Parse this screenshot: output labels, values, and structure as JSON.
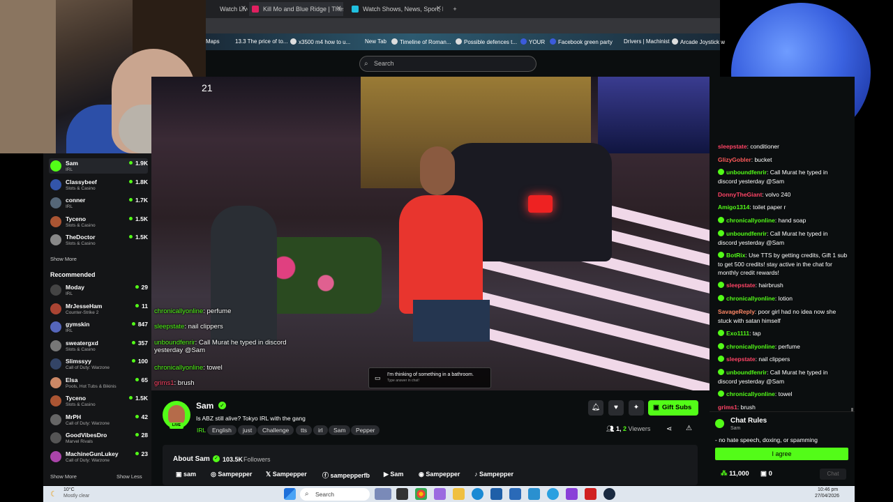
{
  "browser": {
    "tabs": [
      {
        "label": "Watch Live on"
      },
      {
        "label": "Kill Mo and Blue Ridge | These"
      },
      {
        "label": "Watch Shows, News, Sport, Mo"
      }
    ],
    "bookmarks": [
      "Maps",
      "13.3 The price of to...",
      "x3500 m4 how to u...",
      "New Tab",
      "Timeline of Roman...",
      "Possible defences t...",
      "YOUR",
      "Facebook green party",
      "Drivers | Machinist",
      "Arcade Joystick w"
    ]
  },
  "search": {
    "placeholder": "Search"
  },
  "sidebar": {
    "following": [
      {
        "name": "Sam",
        "category": "IRL",
        "viewers": "1.9K",
        "color": "#53fc18"
      },
      {
        "name": "Classybeef",
        "category": "Slots & Casino",
        "viewers": "1.8K",
        "color": "#3355aa"
      },
      {
        "name": "conner",
        "category": "IRL",
        "viewers": "1.7K",
        "color": "#556677"
      },
      {
        "name": "Tyceno",
        "category": "Slots & Casino",
        "viewers": "1.5K",
        "color": "#aa5533"
      },
      {
        "name": "TheDoctor",
        "category": "Slots & Casino",
        "viewers": "1.5K",
        "color": "#888888"
      }
    ],
    "show_more": "Show More",
    "recommended_heading": "Recommended",
    "recommended": [
      {
        "name": "Moday",
        "category": "IRL",
        "viewers": "29",
        "color": "#444444"
      },
      {
        "name": "MrJesseHam",
        "category": "Counter-Strike 2",
        "viewers": "11",
        "color": "#aa4433"
      },
      {
        "name": "gymskin",
        "category": "IRL",
        "viewers": "847",
        "color": "#5566bb"
      },
      {
        "name": "sweatergxd",
        "category": "Slots & Casino",
        "viewers": "357",
        "color": "#777777"
      },
      {
        "name": "Slimssyy",
        "category": "Call of Duty: Warzone",
        "viewers": "100",
        "color": "#334466"
      },
      {
        "name": "Elsa",
        "category": "Pools, Hot Tubs & Bikinis",
        "viewers": "65",
        "color": "#cc8866"
      },
      {
        "name": "Tyceno",
        "category": "Slots & Casino",
        "viewers": "1.5K",
        "color": "#aa5533"
      },
      {
        "name": "MrPH",
        "category": "Call of Duty: Warzone",
        "viewers": "42",
        "color": "#666666"
      },
      {
        "name": "GoodVibesDro",
        "category": "Marvel Rivals",
        "viewers": "28",
        "color": "#555555"
      },
      {
        "name": "MachineGunLukey",
        "category": "Call of Duty: Warzone",
        "viewers": "23",
        "color": "#aa44aa"
      }
    ],
    "show_more_bottom": "Show More",
    "show_less": "Show Less"
  },
  "video": {
    "clock": "21",
    "overlay_chat": [
      {
        "user": "chronicallyonline",
        "msg": ": perfume",
        "color": "#53fc18"
      },
      {
        "user": "sleepstate",
        "msg": ": nail clippers",
        "color": "#53fc18"
      },
      {
        "user": "unboundfenrir",
        "msg": ": Call Murat he typed in discord yesterday @Sam",
        "color": "#53fc18"
      },
      {
        "user": "chronicallyonline",
        "msg": ": towel",
        "color": "#53fc18"
      },
      {
        "user": "grims1",
        "msg": ": brush",
        "color": "#ff4466"
      }
    ],
    "poll_title": "I'm thinking of something in a bathroom.",
    "poll_sub": "Type answer in chat!"
  },
  "stream": {
    "name": "Sam",
    "title": "Is ABZ still alive? Tokyo IRL with the gang",
    "live": "LIVE",
    "tags": [
      "IRL",
      "English",
      "just",
      "Challenge",
      "tts",
      "irl",
      "Sam",
      "Pepper"
    ],
    "viewers_count": "1,",
    "viewers_count2": "2",
    "viewers_label": "Viewers",
    "gift_subs": "Gift Subs",
    "about_label": "About Sam",
    "followers": "103.5K",
    "followers_label": "Followers",
    "socials": [
      "sam",
      "Sampepper",
      "Sampepper",
      "sampepperfb",
      "Sam",
      "Sampepper",
      "Sampepper"
    ]
  },
  "chat": {
    "messages": [
      {
        "user": "sleepstate",
        "msg": ": conditioner",
        "color": "#ff4466",
        "badge": false
      },
      {
        "user": "GlizyGobler",
        "msg": ": bucket",
        "color": "#ff5a5a",
        "badge": false
      },
      {
        "user": "unboundfenrir",
        "msg": ": Call Murat he typed in discord yesterday @Sam",
        "color": "#53fc18",
        "badge": true
      },
      {
        "user": "DonnyTheGiant",
        "msg": ": volvo 240",
        "color": "#ff4466",
        "badge": false
      },
      {
        "user": "Amigo1314",
        "msg": ": toilet paper r",
        "color": "#53fc18",
        "badge": false
      },
      {
        "user": "chronicallyonline",
        "msg": ": hand soap",
        "color": "#53fc18",
        "badge": true
      },
      {
        "user": "unboundfenrir",
        "msg": ": Call Murat he typed in discord yesterday @Sam",
        "color": "#53fc18",
        "badge": true
      },
      {
        "user": "BotRix",
        "msg": ": Use TTS by getting credits, Gift 1 sub to get 500 credits! stay active in the chat for monthly credit rewards!",
        "color": "#53fc18",
        "badge": true
      },
      {
        "user": "sleepstate",
        "msg": ": hairbrush",
        "color": "#ff4466",
        "badge": true
      },
      {
        "user": "chronicallyonline",
        "msg": ": lotion",
        "color": "#53fc18",
        "badge": true
      },
      {
        "user": "SavageReply",
        "msg": ": poor girl had no idea now she stuck with satan himself",
        "color": "#ff8866",
        "badge": false
      },
      {
        "user": "Exo1111",
        "msg": ": tap",
        "color": "#53fc18",
        "badge": true
      },
      {
        "user": "chronicallyonline",
        "msg": ": perfume",
        "color": "#53fc18",
        "badge": true
      },
      {
        "user": "sleepstate",
        "msg": ": nail clippers",
        "color": "#ff4466",
        "badge": true
      },
      {
        "user": "unboundfenrir",
        "msg": ": Call Murat he typed in discord yesterday @Sam",
        "color": "#53fc18",
        "badge": true
      },
      {
        "user": "chronicallyonline",
        "msg": ": towel",
        "color": "#53fc18",
        "badge": true
      },
      {
        "user": "grims1",
        "msg": ": brush",
        "color": "#ff4466",
        "badge": false
      }
    ],
    "rules_title": "Chat Rules",
    "rules_sub": "Sam",
    "rules_text": "- no hate speech, doxing, or spamming",
    "agree": "I agree",
    "points": "11,000",
    "gifts": "0",
    "chat_button": "Chat"
  },
  "taskbar": {
    "weather_temp": "10°C",
    "weather_desc": "Mostly clear",
    "search": "Search",
    "time": "10:46 pm",
    "date": "27/04/2026"
  }
}
